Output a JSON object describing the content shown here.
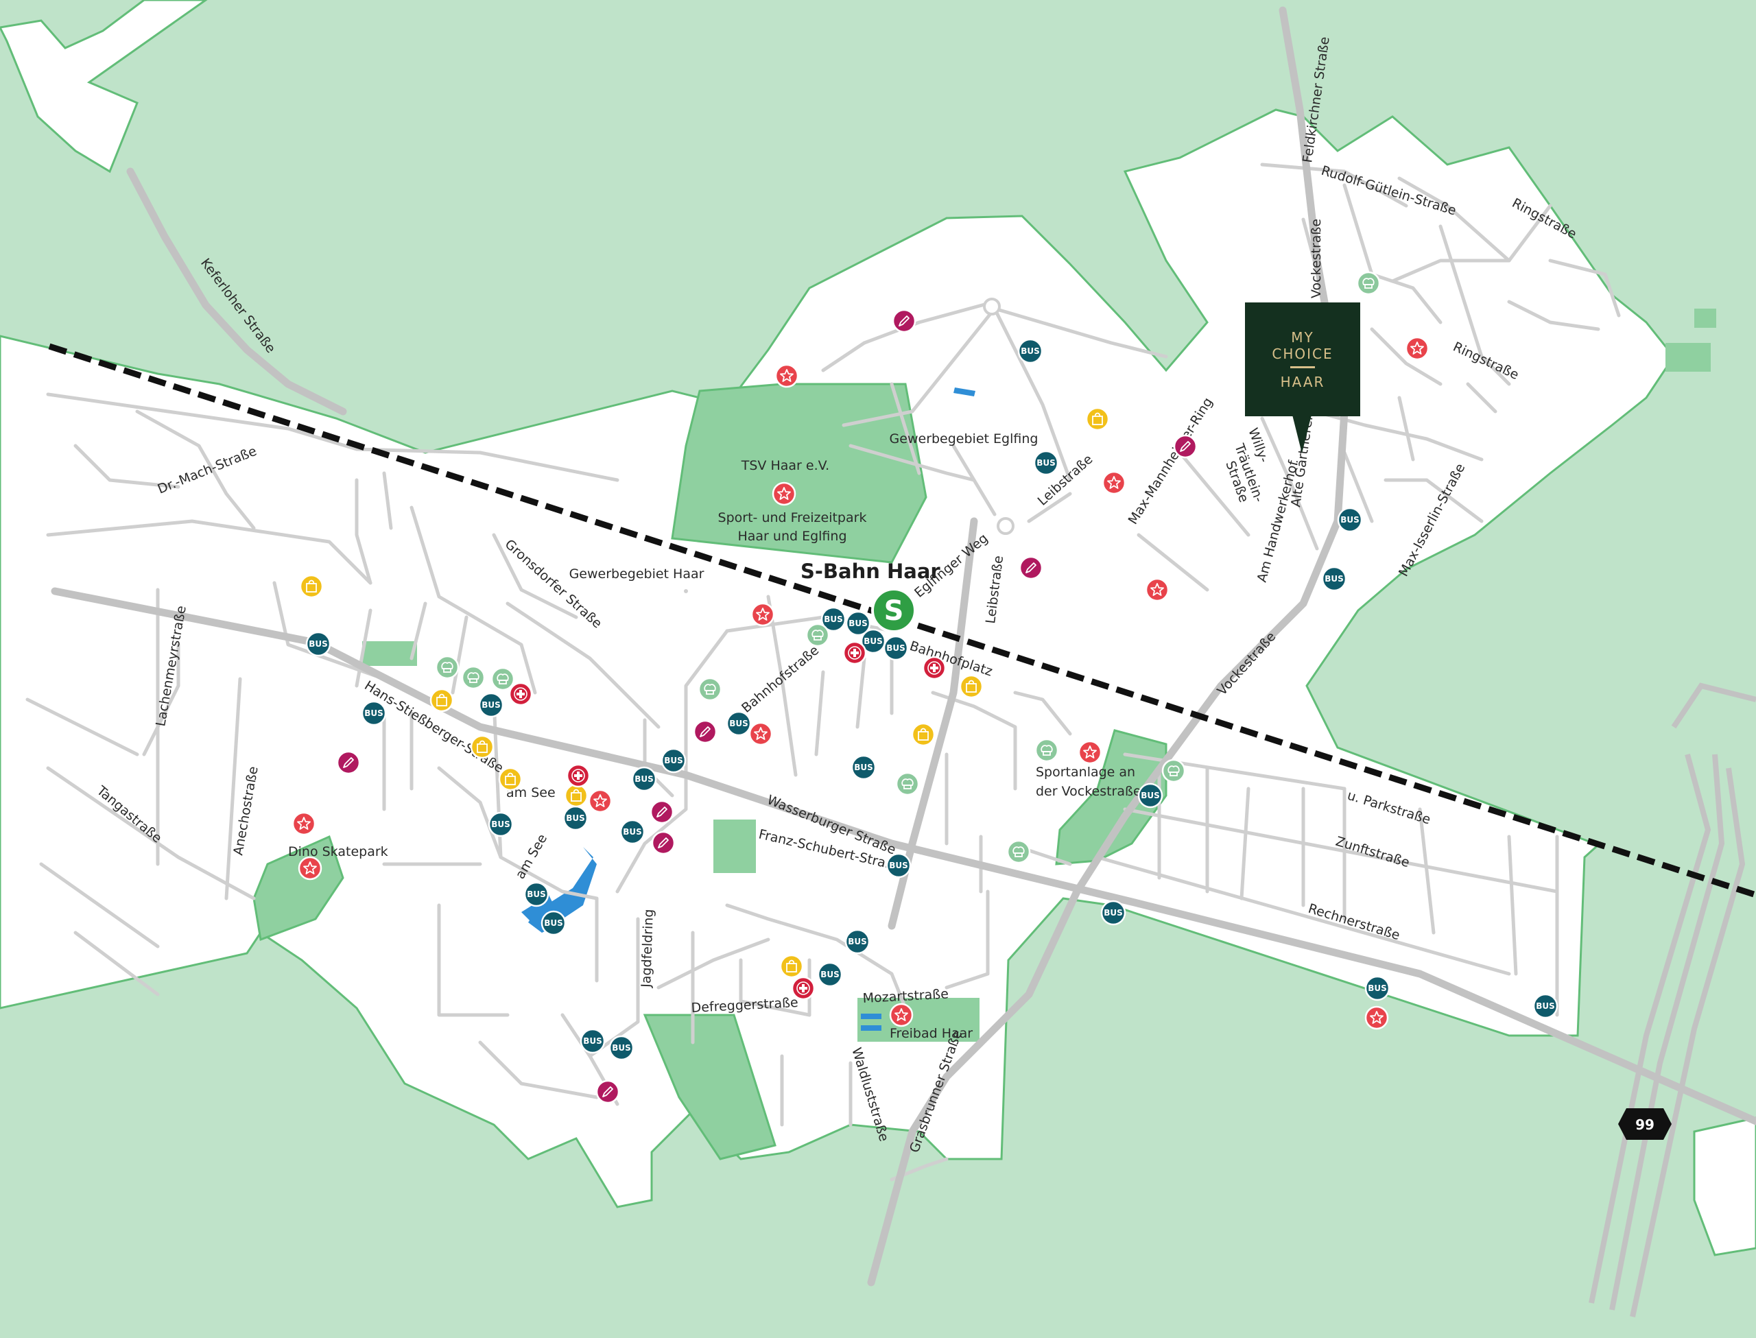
{
  "colors": {
    "land": "#bfe3c9",
    "town": "#ffffff",
    "park": "#8fd0a0",
    "park_border": "#62bd78",
    "street": "#c9c9c9",
    "main_road": "#c2c2c2",
    "railway": "#111111",
    "bus": "#0f5a6b",
    "sbahn": "#2f9e44",
    "leisure": "#e8434b",
    "shopping": "#f2c019",
    "education": "#b0195f",
    "medical": "#d21f3c",
    "food": "#8bc89c",
    "water": "#2f8ed6",
    "marker_bg": "#14301f",
    "marker_text": "#d8c08a"
  },
  "marker": {
    "line1": "MY",
    "line2": "CHOICE",
    "line3": "HAAR"
  },
  "highway_badge": "99",
  "station_label": "S-Bahn Haar",
  "place_labels": {
    "tsv_haar": "TSV Haar e.V.",
    "sportpark1": "Sport- und Freizeitpark",
    "sportpark2": "Haar und Eglfing",
    "gewerbe_eglfing": "Gewerbegebiet Eglfing",
    "gewerbe_haar": "Gewerbegebiet Haar",
    "sportanlage1": "Sportanlage an",
    "sportanlage2": "der Vockestraße",
    "dino": "Dino Skatepark",
    "am_see": "am See",
    "freibad": "Freibad Haar"
  },
  "street_labels": {
    "keferloher": "Keferloher Straße",
    "dr_mach": "Dr.-Mach-Straße",
    "gronsdorfer": "Gronsdorfer Straße",
    "lachenmeyr": "Lachenmeyrstraße",
    "anecho": "Anechostraße",
    "tanga": "Tangastraße",
    "hans_stiessberger": "Hans-Stießberger-Straße",
    "am_see_street": "am See",
    "jagdfeldring": "Jagdfeldring",
    "bahnhofstrasse": "Bahnhofstraße",
    "bahnhofplatz": "Bahnhofplatz",
    "eglfinger_weg": "Eglfinger Weg",
    "leibstrasse_1": "Leibstraße",
    "leibstrasse_2": "Leibstraße",
    "wasserburger": "Wasserburger Straße",
    "franz_schubert": "Franz-Schubert-Straße",
    "defregger": "Defreggerstraße",
    "mozart": "Mozartstraße",
    "waldlust": "Waldluststraße",
    "grasbrunner": "Grasbrunner Straße",
    "vockestrasse_1": "Vockestraße",
    "vockestrasse_2": "Vockestraße",
    "feldkirchner": "Feldkirchner Straße",
    "rudolf_guetlein": "Rudolf-Gütlein-Straße",
    "ringstrasse_1": "Ringstraße",
    "ringstrasse_2": "Ringstraße",
    "max_mannheimer": "Max-Mannheimer-Ring",
    "willy_1": "Willy-",
    "willy_2": "Träutlein-",
    "willy_3": "Straße",
    "alte_gaertnerei": "Alte Gärtnerei",
    "am_handwerkerhof": "Am Handwerkerhof",
    "max_isserlin": "Max-Isserlin-Straße",
    "u_park": "u. Parkstraße",
    "zunft": "Zunftstraße",
    "rechner": "Rechnerstraße"
  },
  "poi_legend": {
    "bus": "BUS",
    "sbahn": "S"
  }
}
